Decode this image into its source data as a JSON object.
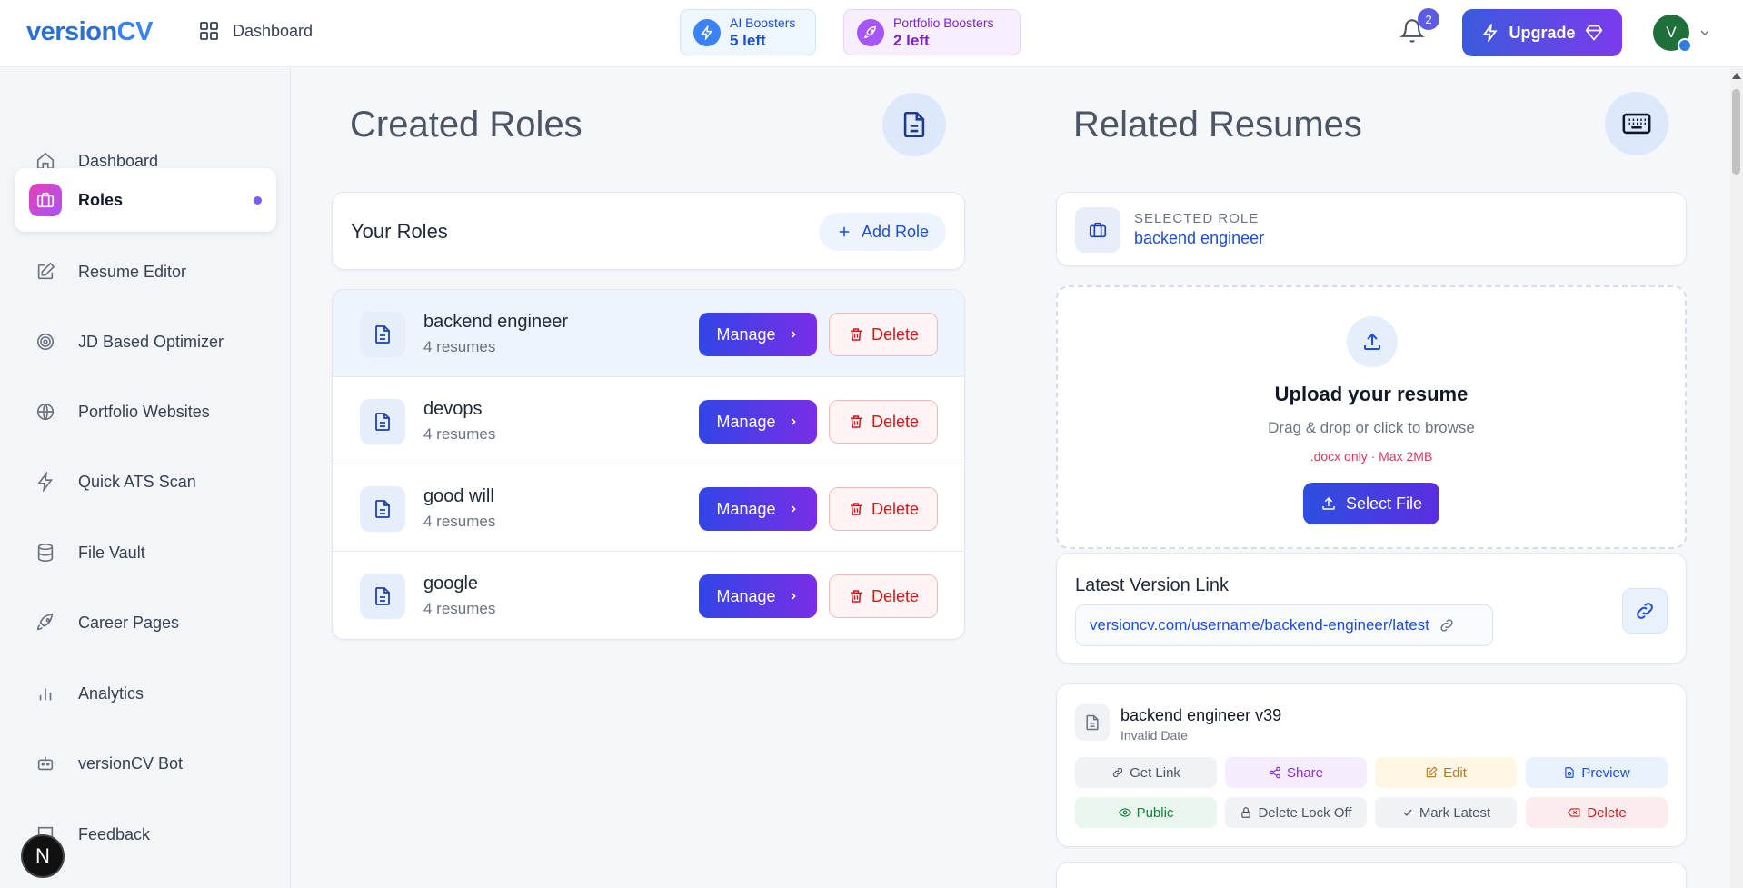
{
  "header": {
    "logo_main": "version",
    "logo_accent": "CV",
    "breadcrumb": "Dashboard",
    "ai_boosters": {
      "label": "AI Boosters",
      "value": "5 left"
    },
    "portfolio_boosters": {
      "label": "Portfolio Boosters",
      "value": "2 left"
    },
    "notification_count": "2",
    "upgrade_label": "Upgrade",
    "avatar_initial": "V"
  },
  "sidebar": {
    "items": [
      {
        "label": "Dashboard",
        "icon": "home-icon"
      },
      {
        "label": "Roles",
        "icon": "briefcase-icon",
        "active": true
      },
      {
        "label": "Resume Editor",
        "icon": "edit-icon"
      },
      {
        "label": "JD Based Optimizer",
        "icon": "target-icon"
      },
      {
        "label": "Portfolio Websites",
        "icon": "globe-icon"
      },
      {
        "label": "Quick ATS Scan",
        "icon": "bolt-icon"
      },
      {
        "label": "File Vault",
        "icon": "database-icon"
      },
      {
        "label": "Career Pages",
        "icon": "rocket-icon"
      },
      {
        "label": "Analytics",
        "icon": "bar-chart-icon"
      },
      {
        "label": "versionCV Bot",
        "icon": "bot-icon"
      },
      {
        "label": "Feedback",
        "icon": "message-icon"
      }
    ],
    "dev_badge": "N"
  },
  "roles": {
    "heading": "Created Roles",
    "panel_title": "Your Roles",
    "add_role_label": "Add Role",
    "manage_label": "Manage",
    "delete_label": "Delete",
    "items": [
      {
        "name": "backend engineer",
        "count": "4 resumes",
        "selected": true
      },
      {
        "name": "devops",
        "count": "4 resumes"
      },
      {
        "name": "good will",
        "count": "4 resumes"
      },
      {
        "name": "google",
        "count": "4 resumes"
      }
    ]
  },
  "resumes": {
    "heading": "Related Resumes",
    "selected_role_label": "SELECTED ROLE",
    "selected_role_value": "backend engineer",
    "upload": {
      "title": "Upload your resume",
      "subtitle": "Drag & drop or click to browse",
      "note": ".docx only · Max 2MB",
      "button": "Select File"
    },
    "latest_version": {
      "title": "Latest Version Link",
      "url": "versioncv.com/username/backend-engineer/latest"
    },
    "version": {
      "name": "backend engineer v39",
      "date": "Invalid Date",
      "actions_row1": [
        "Get Link",
        "Share",
        "Edit",
        "Preview"
      ],
      "actions_row2": [
        "Public",
        "Delete Lock Off",
        "Mark Latest",
        "Delete"
      ]
    }
  },
  "colors": {
    "brand": "#2b6fd6",
    "manage_gradient_start": "#3245e6",
    "manage_gradient_end": "#7a2ee6",
    "delete_red": "#c81e1e"
  }
}
